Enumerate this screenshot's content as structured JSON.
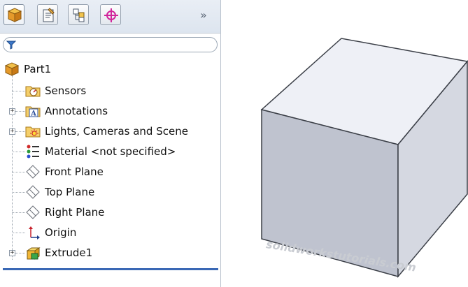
{
  "tabs": [
    {
      "name": "feature-manager",
      "active": true
    },
    {
      "name": "property-manager",
      "active": false
    },
    {
      "name": "configuration-manager",
      "active": false
    },
    {
      "name": "dimxpert-manager",
      "active": false
    }
  ],
  "more_glyph": "»",
  "tree": {
    "root": "Part1",
    "items": [
      {
        "label": "Sensors",
        "icon": "sensors-folder-icon",
        "expandable": false
      },
      {
        "label": "Annotations",
        "icon": "annotations-folder-icon",
        "expandable": true
      },
      {
        "label": "Lights, Cameras and Scene",
        "icon": "lights-folder-icon",
        "expandable": true
      },
      {
        "label": "Material <not specified>",
        "icon": "material-icon",
        "expandable": false
      },
      {
        "label": "Front Plane",
        "icon": "plane-icon",
        "expandable": false
      },
      {
        "label": "Top Plane",
        "icon": "plane-icon",
        "expandable": false
      },
      {
        "label": "Right Plane",
        "icon": "plane-icon",
        "expandable": false
      },
      {
        "label": "Origin",
        "icon": "origin-icon",
        "expandable": false
      },
      {
        "label": "Extrude1",
        "icon": "extrude-icon",
        "expandable": true
      }
    ]
  },
  "watermark": "solidworkstutorials.com",
  "colors": {
    "rollback_bar": "#3a68b5",
    "cube_top": "#f0f2f7",
    "cube_left": "#bfc3cf",
    "cube_right": "#d4d7e0"
  }
}
